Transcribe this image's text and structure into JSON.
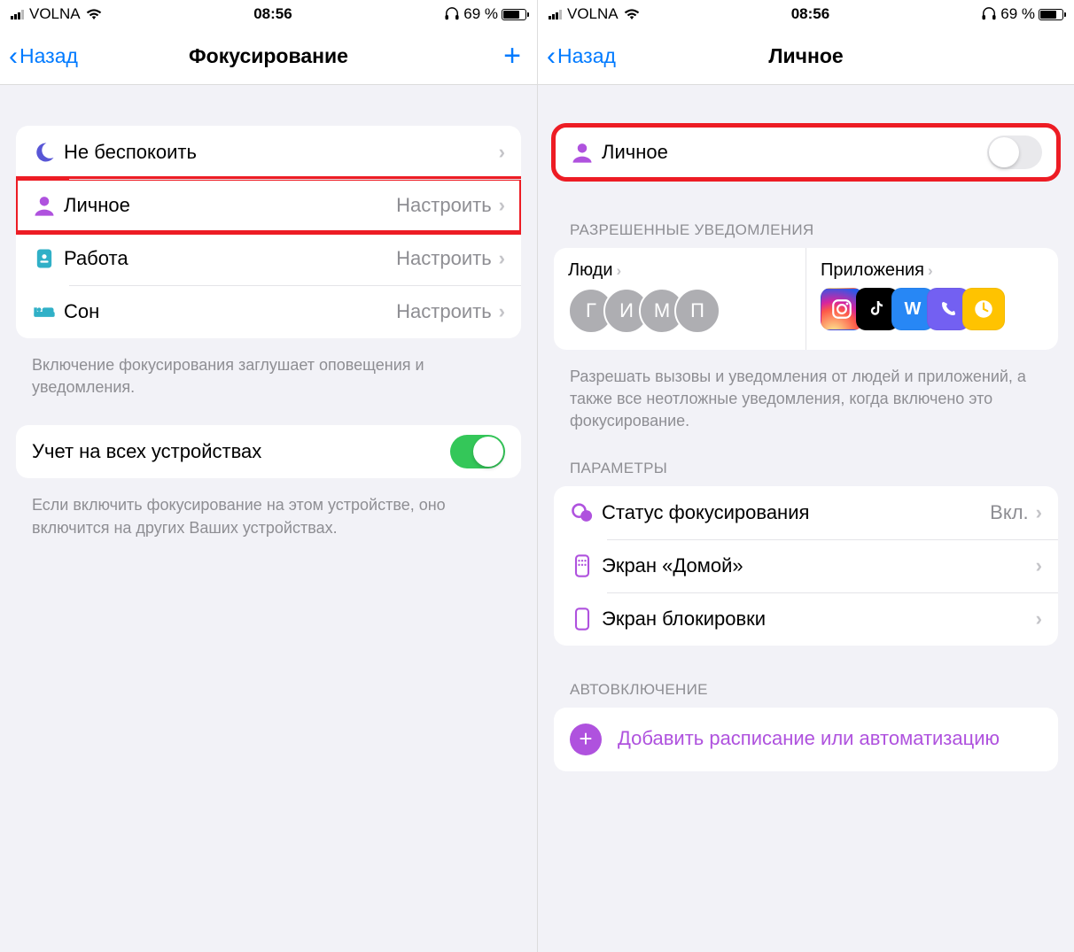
{
  "status": {
    "carrier": "VOLNA",
    "time": "08:56",
    "battery_pct": "69 %"
  },
  "left": {
    "back": "Назад",
    "title": "Фокусирование",
    "modes": [
      {
        "label": "Не беспокоить",
        "detail": "",
        "icon": "moon",
        "color": "#5856d6"
      },
      {
        "label": "Личное",
        "detail": "Настроить",
        "icon": "person",
        "color": "#af52de"
      },
      {
        "label": "Работа",
        "detail": "Настроить",
        "icon": "badge",
        "color": "#30b0c7"
      },
      {
        "label": "Сон",
        "detail": "Настроить",
        "icon": "bed",
        "color": "#30b0c7"
      }
    ],
    "footer1": "Включение фокусирования заглушает оповещения и уведомления.",
    "share_label": "Учет на всех устройствах",
    "footer2": "Если включить фокусирование на этом устройстве, оно включится на других Ваших устройствах."
  },
  "right": {
    "back": "Назад",
    "title": "Личное",
    "toggle_label": "Личное",
    "allowed_header": "РАЗРЕШЕННЫЕ УВЕДОМЛЕНИЯ",
    "people_label": "Люди",
    "apps_label": "Приложения",
    "people": [
      "Г",
      "И",
      "М",
      "П"
    ],
    "allowed_footer": "Разрешать вызовы и уведомления от людей и приложений, а также все неотложные уведомления, когда включено это фокусирование.",
    "options_header": "ПАРАМЕТРЫ",
    "options": [
      {
        "label": "Статус фокусирования",
        "detail": "Вкл.",
        "icon": "status"
      },
      {
        "label": "Экран «Домой»",
        "detail": "",
        "icon": "home-screen"
      },
      {
        "label": "Экран блокировки",
        "detail": "",
        "icon": "lock-screen"
      }
    ],
    "auto_header": "АВТОВКЛЮЧЕНИЕ",
    "add_label": "Добавить расписание или автоматизацию"
  }
}
